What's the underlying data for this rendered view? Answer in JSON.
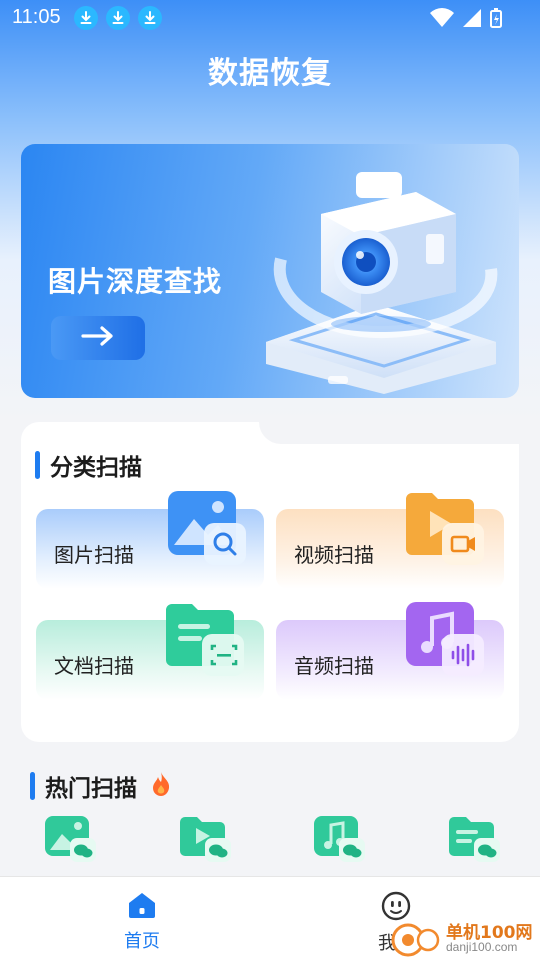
{
  "status": {
    "time": "11:05"
  },
  "header": {
    "title": "数据恢复"
  },
  "banner": {
    "title": "图片深度查找",
    "button_icon": "arrow-right-icon"
  },
  "category": {
    "title": "分类扫描",
    "items": [
      {
        "label": "图片扫描",
        "icon": "image-search-icon"
      },
      {
        "label": "视频扫描",
        "icon": "video-folder-icon"
      },
      {
        "label": "文档扫描",
        "icon": "document-scan-icon"
      },
      {
        "label": "音频扫描",
        "icon": "audio-music-icon"
      }
    ]
  },
  "hot": {
    "title": "热门扫描",
    "badge_icon": "fire-icon",
    "items": [
      {
        "icon": "wechat-image-icon"
      },
      {
        "icon": "wechat-video-icon"
      },
      {
        "icon": "wechat-audio-icon"
      },
      {
        "icon": "wechat-document-icon"
      }
    ]
  },
  "nav": {
    "items": [
      {
        "label": "首页",
        "icon": "home-icon",
        "active": true
      },
      {
        "label": "我的",
        "icon": "smiley-face-icon",
        "active": false
      }
    ]
  },
  "watermark": {
    "text": "单机100网",
    "subtext": "danji100.com"
  },
  "colors": {
    "accent": "#1e7cf0",
    "nav_active": "#1e7cf0"
  }
}
